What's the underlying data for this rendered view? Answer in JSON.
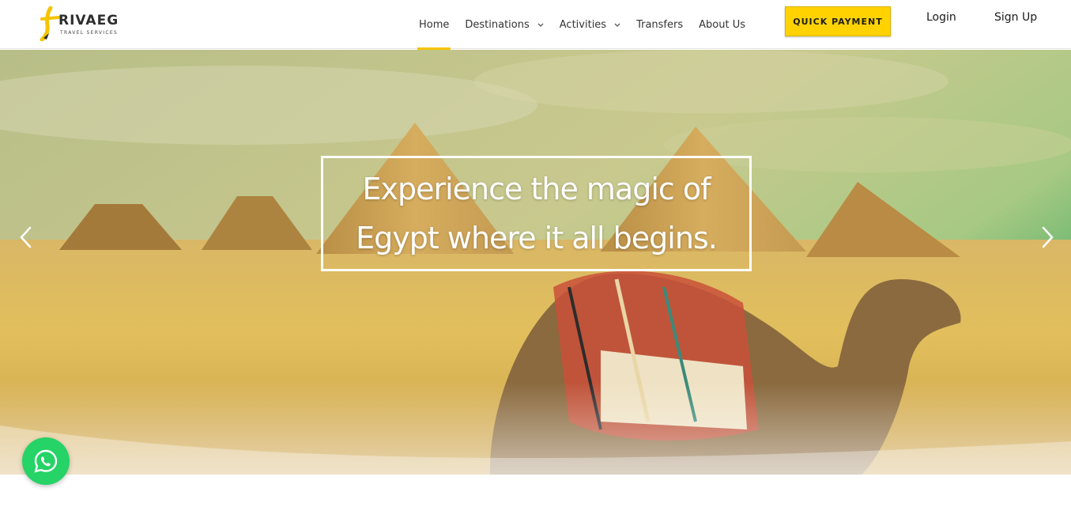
{
  "logo": {
    "brand": "RIVAEG",
    "tagline": "TRAVEL SERVICES",
    "mark_letter": "t"
  },
  "nav": {
    "items": [
      {
        "label": "Home",
        "active": true,
        "dropdown": false
      },
      {
        "label": "Destinations",
        "active": false,
        "dropdown": true
      },
      {
        "label": "Activities",
        "active": false,
        "dropdown": true
      },
      {
        "label": "Transfers",
        "active": false,
        "dropdown": false
      },
      {
        "label": "About Us",
        "active": false,
        "dropdown": false
      }
    ],
    "dropdown_icon": "chevron-down-icon"
  },
  "header_actions": {
    "quick_payment_label": "QUICK PAYMENT",
    "login_label": "Login",
    "signup_label": "Sign Up"
  },
  "hero": {
    "caption_line1": "Experience the magic of",
    "caption_line2": "Egypt where it all begins.",
    "prev_icon": "chevron-left-icon",
    "next_icon": "chevron-right-icon"
  },
  "floating": {
    "whatsapp_icon": "whatsapp-icon"
  },
  "colors": {
    "accent": "#ffd200",
    "active_underline": "#f5c400",
    "whatsapp": "#25d366"
  }
}
